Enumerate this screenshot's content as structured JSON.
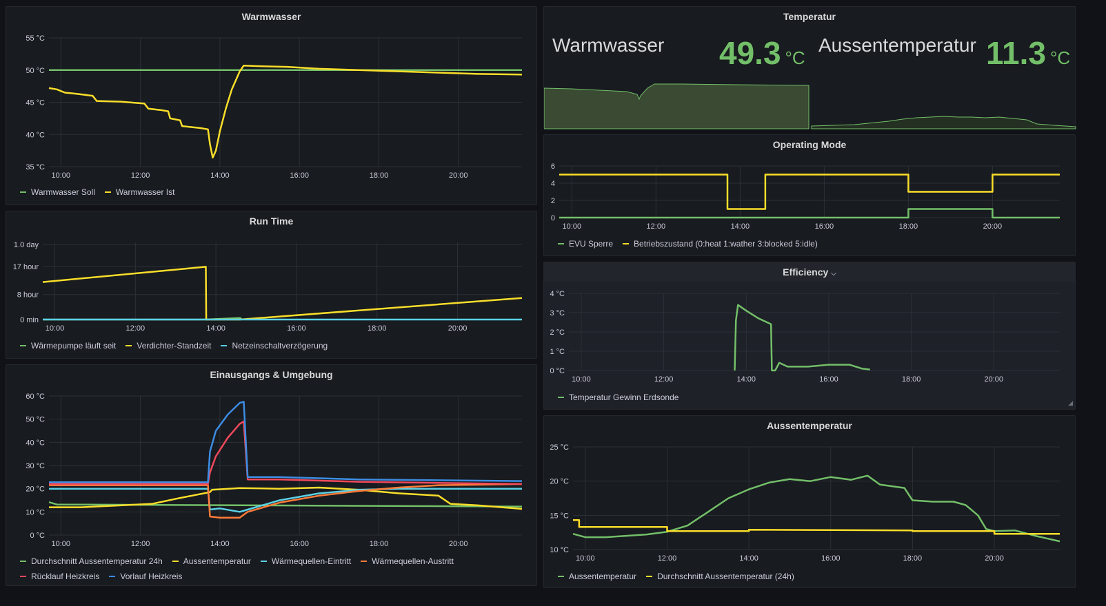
{
  "colors": {
    "green": "#73bf69",
    "yellow": "#fade2a",
    "light_blue": "#5ad1e7",
    "orange": "#ff7c39",
    "red": "#f2495c",
    "blue": "#3d8de3",
    "grid": "#2c3038",
    "tick": "#ccccdc"
  },
  "panels": {
    "warmwasser": {
      "title": "Warmwasser",
      "chart_data": {
        "type": "line",
        "title": "Warmwasser",
        "x_ticks": [
          "10:00",
          "12:00",
          "14:00",
          "16:00",
          "18:00",
          "20:00"
        ],
        "y_ticks": [
          "35 °C",
          "40 °C",
          "45 °C",
          "50 °C",
          "55 °C"
        ],
        "ylim": [
          35,
          55
        ],
        "xlim_hours": [
          9.7,
          21.6
        ],
        "legend": "bottom-left",
        "series": [
          {
            "name": "Warmwasser Soll",
            "color": "green",
            "points": [
              [
                9.7,
                50
              ],
              [
                21.6,
                50
              ]
            ]
          },
          {
            "name": "Warmwasser Ist",
            "color": "yellow",
            "points": [
              [
                9.7,
                47.2
              ],
              [
                9.9,
                47.0
              ],
              [
                10.1,
                46.5
              ],
              [
                10.4,
                46.3
              ],
              [
                10.8,
                46.0
              ],
              [
                10.9,
                45.2
              ],
              [
                11.5,
                45.1
              ],
              [
                12.1,
                44.8
              ],
              [
                12.2,
                44.0
              ],
              [
                12.5,
                43.8
              ],
              [
                12.7,
                43.6
              ],
              [
                12.75,
                42.5
              ],
              [
                13.0,
                42.2
              ],
              [
                13.05,
                41.3
              ],
              [
                13.5,
                41.0
              ],
              [
                13.7,
                40.8
              ],
              [
                13.75,
                38.5
              ],
              [
                13.82,
                36.4
              ],
              [
                13.9,
                37.5
              ],
              [
                14.0,
                40.5
              ],
              [
                14.15,
                44.0
              ],
              [
                14.3,
                47.0
              ],
              [
                14.5,
                49.8
              ],
              [
                14.6,
                50.7
              ],
              [
                15.0,
                50.6
              ],
              [
                15.7,
                50.5
              ],
              [
                16.5,
                50.2
              ],
              [
                17.5,
                50.0
              ],
              [
                18.5,
                49.8
              ],
              [
                19.5,
                49.6
              ],
              [
                20.5,
                49.4
              ],
              [
                21.6,
                49.3
              ]
            ]
          }
        ]
      }
    },
    "temperatur": {
      "title": "Temperatur",
      "stats": [
        {
          "name": "Warmwasser",
          "value": "49.3",
          "unit": "°C",
          "color": "green"
        },
        {
          "name": "Aussentemperatur",
          "value": "11.3",
          "unit": "°C",
          "color": "green"
        }
      ]
    },
    "runtime": {
      "title": "Run Time",
      "chart_data": {
        "type": "line",
        "title": "Run Time",
        "x_ticks": [
          "10:00",
          "12:00",
          "14:00",
          "16:00",
          "18:00",
          "20:00"
        ],
        "y_ticks": [
          "0 min",
          "8 hour",
          "17 hour",
          "1.0 day"
        ],
        "ylim_hours": [
          0,
          24.7
        ],
        "xlim_hours": [
          9.7,
          21.6
        ],
        "legend": "bottom-left",
        "series": [
          {
            "name": "Wärmepumpe läuft seit",
            "color": "green",
            "points": [
              [
                9.7,
                0
              ],
              [
                13.75,
                0
              ],
              [
                14.6,
                0.5
              ],
              [
                14.65,
                0
              ]
            ]
          },
          {
            "name": "Verdichter-Standzeit",
            "color": "yellow",
            "points": [
              [
                9.7,
                12.0
              ],
              [
                13.75,
                16.9
              ],
              [
                13.76,
                0
              ],
              [
                14.6,
                0
              ],
              [
                21.6,
                6.9
              ]
            ]
          },
          {
            "name": "Netzeinschaltverzögerung",
            "color": "light_blue",
            "points": [
              [
                9.7,
                0
              ],
              [
                21.6,
                0
              ]
            ]
          }
        ]
      }
    },
    "einausgang": {
      "title": "Einausgangs & Umgebung",
      "chart_data": {
        "type": "line",
        "title": "Einausgangs & Umgebung",
        "x_ticks": [
          "10:00",
          "12:00",
          "14:00",
          "16:00",
          "18:00",
          "20:00"
        ],
        "y_ticks": [
          "0 °C",
          "10 °C",
          "20 °C",
          "30 °C",
          "40 °C",
          "50 °C",
          "60 °C"
        ],
        "ylim": [
          0,
          60
        ],
        "xlim_hours": [
          9.7,
          21.6
        ],
        "legend": "bottom-left",
        "series": [
          {
            "name": "Durchschnitt Aussentemperatur 24h",
            "color": "green",
            "points": [
              [
                9.7,
                14.2
              ],
              [
                9.9,
                13.2
              ],
              [
                21.6,
                12.3
              ]
            ]
          },
          {
            "name": "Aussentemperatur",
            "color": "yellow",
            "points": [
              [
                9.7,
                12
              ],
              [
                10.5,
                12
              ],
              [
                11.5,
                12.8
              ],
              [
                12.3,
                13.5
              ],
              [
                13.0,
                16
              ],
              [
                13.75,
                18.5
              ],
              [
                13.8,
                19.5
              ],
              [
                14.5,
                20.3
              ],
              [
                15.5,
                20
              ],
              [
                16.5,
                20.5
              ],
              [
                17.5,
                19.5
              ],
              [
                18.5,
                18
              ],
              [
                19.5,
                17
              ],
              [
                19.8,
                13.5
              ],
              [
                20.5,
                12.8
              ],
              [
                21.6,
                11.3
              ]
            ]
          },
          {
            "name": "Wärmequellen-Eintritt",
            "color": "light_blue",
            "points": [
              [
                9.7,
                20
              ],
              [
                13.7,
                20
              ],
              [
                13.75,
                11
              ],
              [
                14.0,
                11.5
              ],
              [
                14.5,
                10
              ],
              [
                14.7,
                11
              ],
              [
                15.5,
                15
              ],
              [
                16.5,
                18
              ],
              [
                17.5,
                19.5
              ],
              [
                18.5,
                20
              ],
              [
                21.6,
                20
              ]
            ]
          },
          {
            "name": "Wärmequellen-Austritt",
            "color": "orange",
            "points": [
              [
                9.7,
                21.5
              ],
              [
                13.7,
                21.5
              ],
              [
                13.75,
                8
              ],
              [
                14.0,
                7.5
              ],
              [
                14.5,
                7.5
              ],
              [
                14.7,
                10
              ],
              [
                15.5,
                14
              ],
              [
                16.5,
                17
              ],
              [
                17.5,
                19
              ],
              [
                18.5,
                20.5
              ],
              [
                19.5,
                21.5
              ],
              [
                21.6,
                22
              ]
            ]
          },
          {
            "name": "Rücklauf Heizkreis",
            "color": "red",
            "points": [
              [
                9.7,
                22
              ],
              [
                13.7,
                22
              ],
              [
                13.75,
                27
              ],
              [
                13.9,
                34
              ],
              [
                14.2,
                42
              ],
              [
                14.5,
                48
              ],
              [
                14.6,
                49
              ],
              [
                14.7,
                24
              ],
              [
                15.5,
                24
              ],
              [
                17.5,
                23
              ],
              [
                21.6,
                22
              ]
            ]
          },
          {
            "name": "Vorlauf Heizkreis",
            "color": "blue",
            "points": [
              [
                9.7,
                22.8
              ],
              [
                13.7,
                22.8
              ],
              [
                13.75,
                36
              ],
              [
                13.9,
                45
              ],
              [
                14.2,
                52
              ],
              [
                14.5,
                57
              ],
              [
                14.6,
                57.5
              ],
              [
                14.7,
                25
              ],
              [
                15.5,
                25
              ],
              [
                17.5,
                24
              ],
              [
                21.6,
                23.3
              ]
            ]
          }
        ]
      }
    },
    "operating": {
      "title": "Operating Mode",
      "chart_data": {
        "type": "line",
        "title": "Operating Mode",
        "x_ticks": [
          "10:00",
          "12:00",
          "14:00",
          "16:00",
          "18:00",
          "20:00"
        ],
        "y_ticks": [
          "0",
          "2",
          "4",
          "6"
        ],
        "ylim": [
          0,
          6
        ],
        "xlim_hours": [
          9.7,
          21.6
        ],
        "legend": "bottom-left",
        "series": [
          {
            "name": "EVU Sperre",
            "color": "green",
            "points": [
              [
                9.7,
                0
              ],
              [
                18.0,
                0
              ],
              [
                18.0,
                1
              ],
              [
                20.0,
                1
              ],
              [
                20.0,
                0
              ],
              [
                21.6,
                0
              ]
            ]
          },
          {
            "name": "Betriebszustand (0:heat 1:wather 3:blocked 5:idle)",
            "color": "yellow",
            "points": [
              [
                9.7,
                5
              ],
              [
                13.7,
                5
              ],
              [
                13.7,
                1
              ],
              [
                14.6,
                1
              ],
              [
                14.6,
                5
              ],
              [
                18.0,
                5
              ],
              [
                18.0,
                3
              ],
              [
                20.0,
                3
              ],
              [
                20.0,
                5
              ],
              [
                21.6,
                5
              ]
            ]
          }
        ]
      }
    },
    "efficiency": {
      "title": "Efficiency",
      "chart_data": {
        "type": "line",
        "title": "Efficiency",
        "x_ticks": [
          "10:00",
          "12:00",
          "14:00",
          "16:00",
          "18:00",
          "20:00"
        ],
        "y_ticks": [
          "0 °C",
          "1 °C",
          "2 °C",
          "3 °C",
          "4 °C"
        ],
        "ylim": [
          0,
          4
        ],
        "xlim_hours": [
          9.7,
          21.6
        ],
        "legend": "bottom-left",
        "series": [
          {
            "name": "Temperatur Gewinn Erdsonde",
            "color": "green",
            "points": [
              [
                13.72,
                0
              ],
              [
                13.75,
                2.6
              ],
              [
                13.8,
                3.4
              ],
              [
                14.0,
                3.1
              ],
              [
                14.3,
                2.7
              ],
              [
                14.6,
                2.4
              ],
              [
                14.62,
                0
              ],
              [
                14.7,
                0
              ],
              [
                14.8,
                0.4
              ],
              [
                15.0,
                0.2
              ],
              [
                15.5,
                0.2
              ],
              [
                16.0,
                0.3
              ],
              [
                16.5,
                0.3
              ],
              [
                16.8,
                0.1
              ],
              [
                17.0,
                0.05
              ]
            ]
          }
        ]
      }
    },
    "aussentemperatur": {
      "title": "Aussentemperatur",
      "chart_data": {
        "type": "line",
        "title": "Aussentemperatur",
        "x_ticks": [
          "10:00",
          "12:00",
          "14:00",
          "16:00",
          "18:00",
          "20:00"
        ],
        "y_ticks": [
          "10 °C",
          "15 °C",
          "20 °C",
          "25 °C"
        ],
        "ylim": [
          10,
          25
        ],
        "xlim_hours": [
          9.7,
          21.6
        ],
        "legend": "bottom-left",
        "series": [
          {
            "name": "Aussentemperatur",
            "color": "green",
            "points": [
              [
                9.7,
                12.3
              ],
              [
                10.0,
                11.8
              ],
              [
                10.5,
                11.8
              ],
              [
                11.0,
                12.0
              ],
              [
                11.5,
                12.2
              ],
              [
                12.0,
                12.6
              ],
              [
                12.5,
                13.5
              ],
              [
                13.0,
                15.5
              ],
              [
                13.5,
                17.5
              ],
              [
                14.0,
                18.8
              ],
              [
                14.5,
                19.8
              ],
              [
                15.0,
                20.3
              ],
              [
                15.5,
                20.0
              ],
              [
                16.0,
                20.6
              ],
              [
                16.5,
                20.2
              ],
              [
                16.9,
                20.8
              ],
              [
                17.2,
                19.5
              ],
              [
                17.8,
                19.0
              ],
              [
                18.0,
                17.2
              ],
              [
                18.5,
                17.0
              ],
              [
                19.0,
                17.0
              ],
              [
                19.3,
                16.5
              ],
              [
                19.6,
                15.0
              ],
              [
                19.8,
                13.0
              ],
              [
                20.0,
                12.7
              ],
              [
                20.5,
                12.8
              ],
              [
                21.0,
                12.0
              ],
              [
                21.6,
                11.2
              ]
            ]
          },
          {
            "name": "Durchschnitt Aussentemperatur (24h)",
            "color": "yellow",
            "points": [
              [
                9.7,
                14.3
              ],
              [
                9.85,
                14.3
              ],
              [
                9.85,
                13.3
              ],
              [
                12.0,
                13.3
              ],
              [
                12.0,
                12.7
              ],
              [
                14.0,
                12.7
              ],
              [
                14.0,
                12.9
              ],
              [
                18.0,
                12.8
              ],
              [
                18.0,
                12.7
              ],
              [
                20.0,
                12.7
              ],
              [
                20.0,
                12.3
              ],
              [
                21.6,
                12.3
              ]
            ]
          }
        ]
      }
    }
  }
}
